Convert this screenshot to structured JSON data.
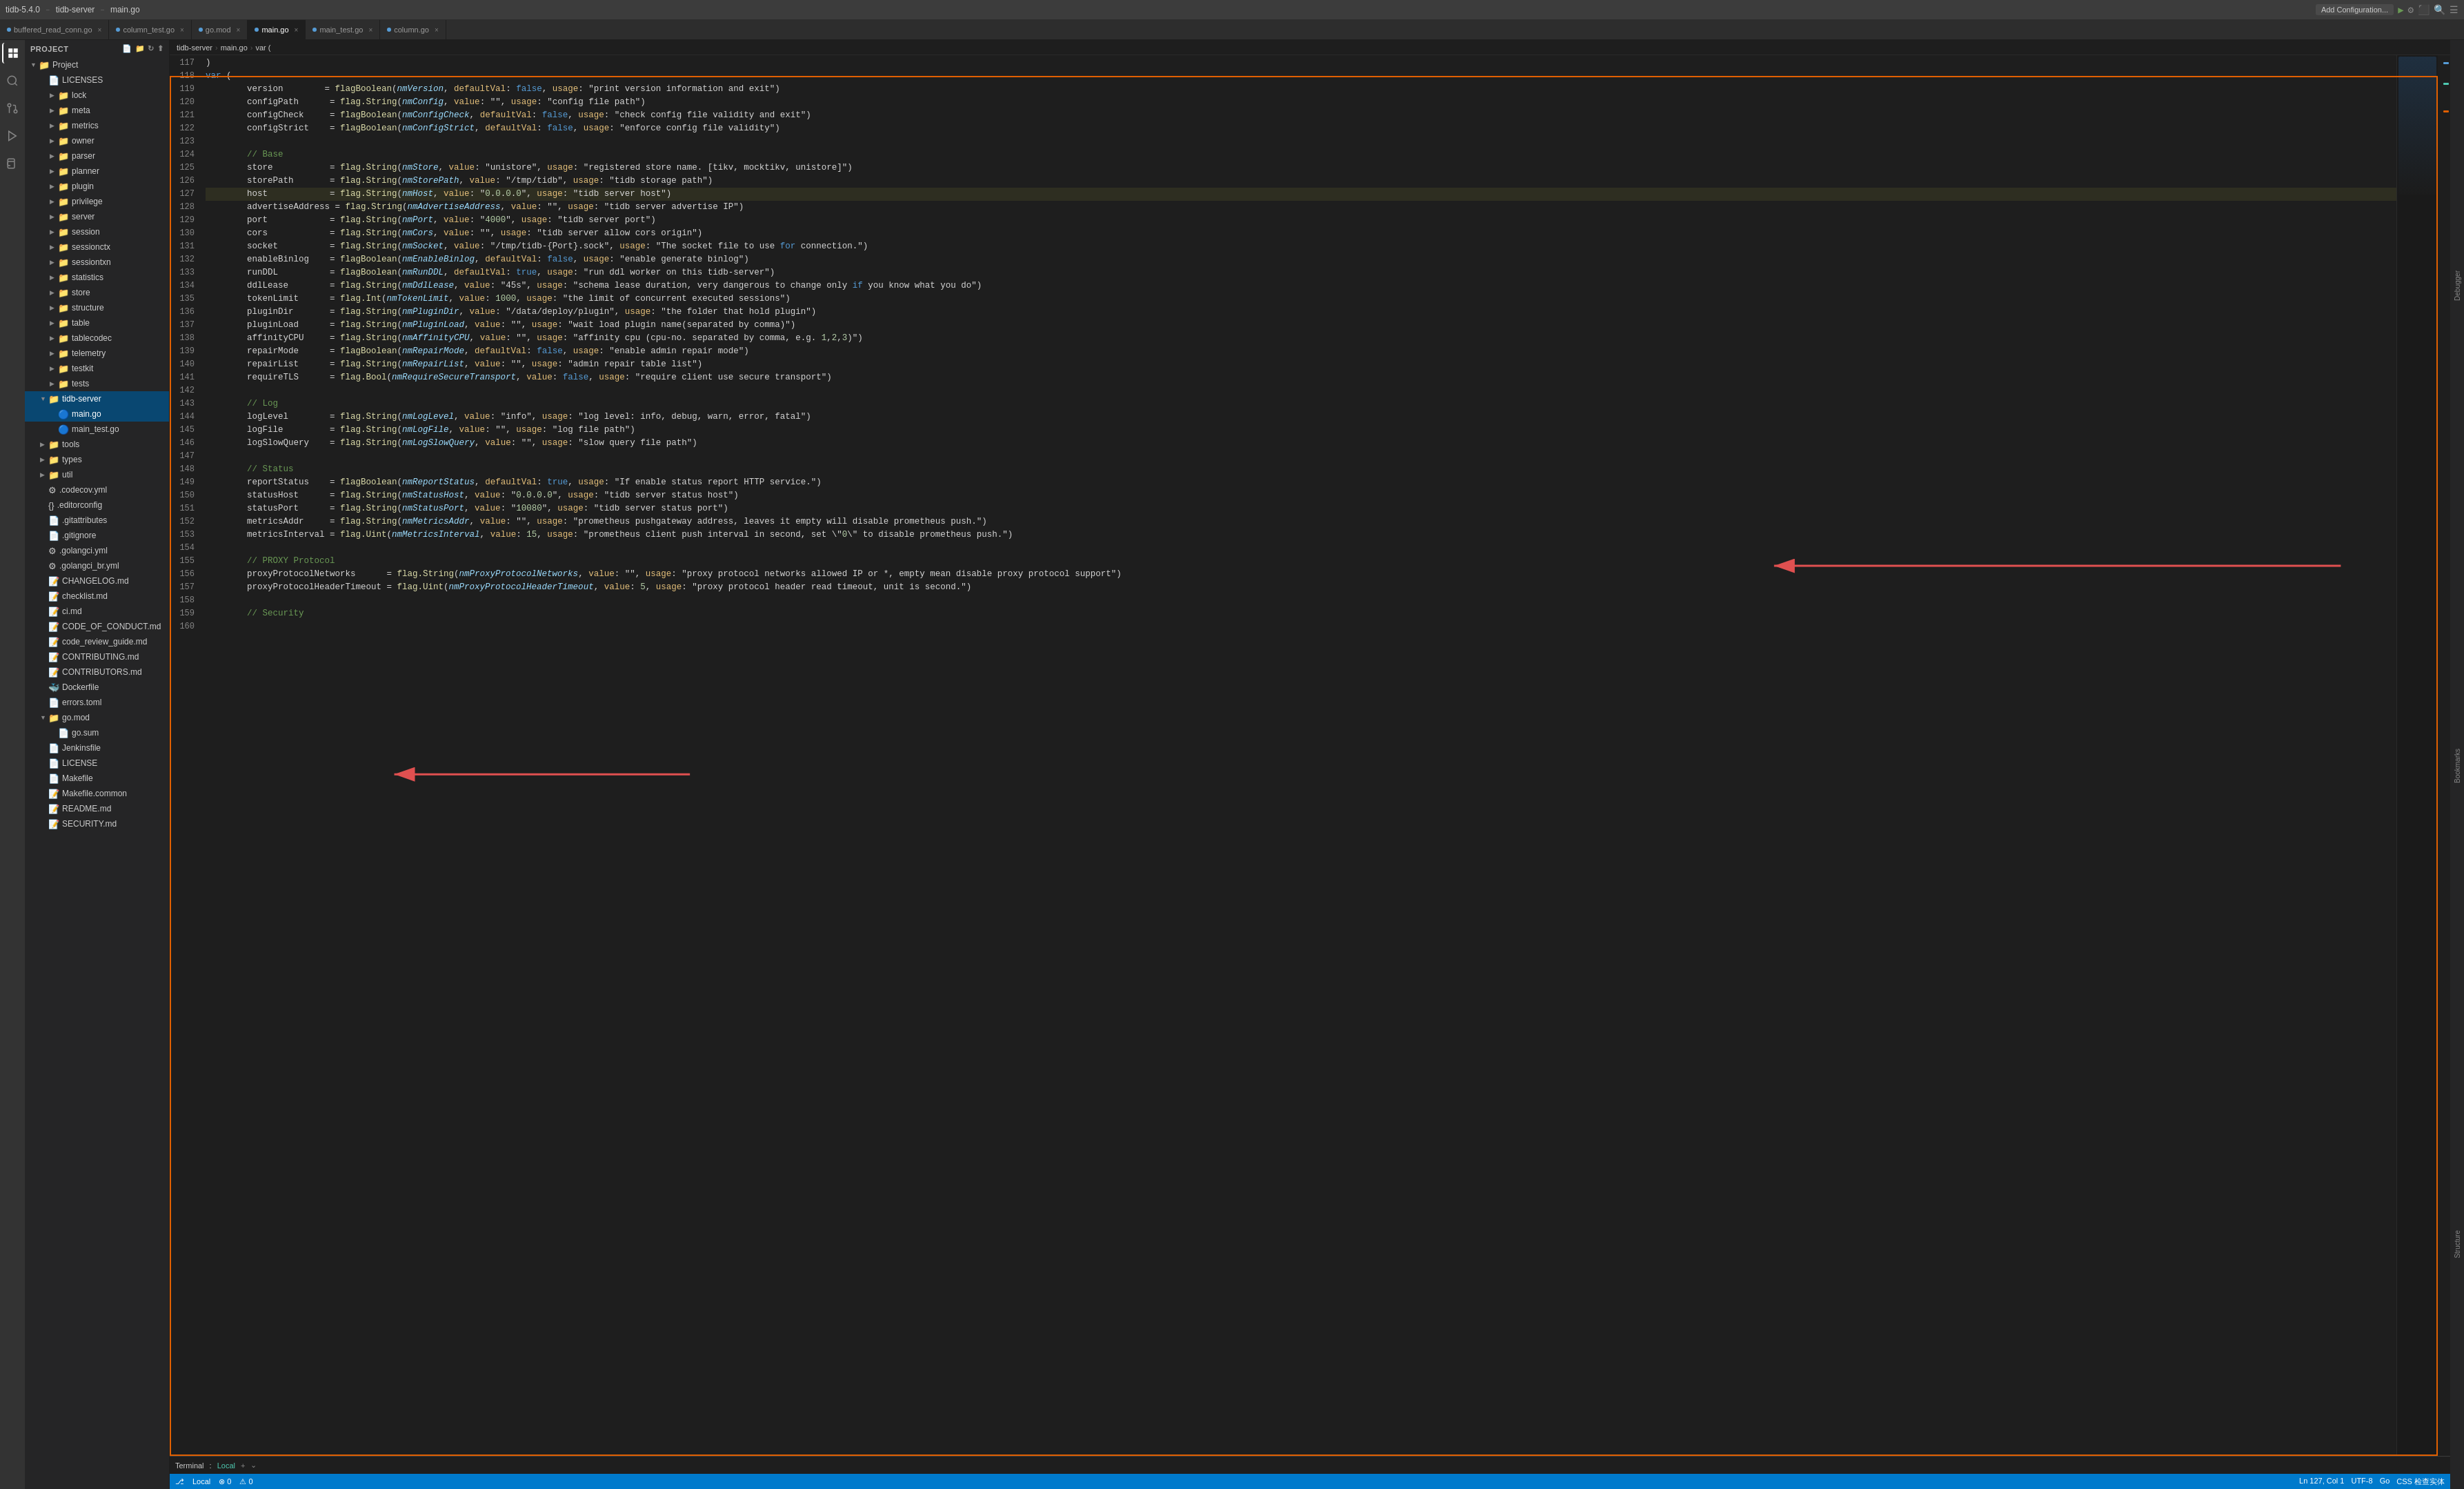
{
  "titleBar": {
    "appName": "tidb-5.4.0",
    "separator": "–",
    "file": "tidb-server",
    "subfile": "main.go",
    "addConfig": "Add Configuration...",
    "searchIcon": "🔍"
  },
  "tabs": [
    {
      "label": "buffered_read_conn.go",
      "active": false,
      "dotColor": "#569cd6"
    },
    {
      "label": "column_test.go",
      "active": false,
      "dotColor": "#569cd6"
    },
    {
      "label": "go.mod",
      "active": false,
      "dotColor": "#569cd6"
    },
    {
      "label": "main.go",
      "active": true,
      "dotColor": "#569cd6"
    },
    {
      "label": "main_test.go",
      "active": false,
      "dotColor": "#569cd6"
    },
    {
      "label": "column.go",
      "active": false,
      "dotColor": "#569cd6"
    }
  ],
  "breadcrumb": {
    "parts": [
      "tidb-server",
      ">",
      "main.go",
      ">",
      "var ("
    ]
  },
  "sidebar": {
    "header": "Project",
    "items": [
      {
        "indent": 0,
        "type": "folder",
        "open": true,
        "label": "Project"
      },
      {
        "indent": 1,
        "type": "file",
        "label": "LICENSES",
        "ext": "none"
      },
      {
        "indent": 2,
        "type": "folder",
        "open": false,
        "label": "lock"
      },
      {
        "indent": 2,
        "type": "folder",
        "open": false,
        "label": "meta"
      },
      {
        "indent": 2,
        "type": "folder",
        "open": false,
        "label": "metrics"
      },
      {
        "indent": 2,
        "type": "folder",
        "open": false,
        "label": "owner"
      },
      {
        "indent": 2,
        "type": "folder",
        "open": false,
        "label": "parser"
      },
      {
        "indent": 2,
        "type": "folder",
        "open": false,
        "label": "planner"
      },
      {
        "indent": 2,
        "type": "folder",
        "open": false,
        "label": "plugin"
      },
      {
        "indent": 2,
        "type": "folder",
        "open": false,
        "label": "privilege"
      },
      {
        "indent": 2,
        "type": "folder",
        "open": false,
        "label": "server"
      },
      {
        "indent": 2,
        "type": "folder",
        "open": false,
        "label": "session"
      },
      {
        "indent": 2,
        "type": "folder",
        "open": false,
        "label": "sessionctx"
      },
      {
        "indent": 2,
        "type": "folder",
        "open": false,
        "label": "sessiontxn"
      },
      {
        "indent": 2,
        "type": "folder",
        "open": false,
        "label": "statistics"
      },
      {
        "indent": 2,
        "type": "folder",
        "open": false,
        "label": "store"
      },
      {
        "indent": 2,
        "type": "folder",
        "open": false,
        "label": "structure"
      },
      {
        "indent": 2,
        "type": "folder",
        "open": false,
        "label": "table"
      },
      {
        "indent": 2,
        "type": "folder",
        "open": false,
        "label": "tablecodec"
      },
      {
        "indent": 2,
        "type": "folder",
        "open": false,
        "label": "telemetry"
      },
      {
        "indent": 2,
        "type": "folder",
        "open": false,
        "label": "testkit"
      },
      {
        "indent": 2,
        "type": "folder",
        "open": false,
        "label": "tests"
      },
      {
        "indent": 1,
        "type": "folder",
        "open": true,
        "label": "tidb-server",
        "selected": true
      },
      {
        "indent": 2,
        "type": "gofile",
        "label": "main.go",
        "selected": true
      },
      {
        "indent": 2,
        "type": "gofile",
        "label": "main_test.go"
      },
      {
        "indent": 1,
        "type": "folder",
        "open": false,
        "label": "tools"
      },
      {
        "indent": 1,
        "type": "folder",
        "open": false,
        "label": "types"
      },
      {
        "indent": 1,
        "type": "folder",
        "open": false,
        "label": "util"
      },
      {
        "indent": 1,
        "type": "yamlfile",
        "label": ".codecov.yml"
      },
      {
        "indent": 1,
        "type": "jsonfile",
        "label": ".editorconfig"
      },
      {
        "indent": 1,
        "type": "file",
        "label": ".gitattributes"
      },
      {
        "indent": 1,
        "type": "file",
        "label": ".gitignore"
      },
      {
        "indent": 1,
        "type": "yamlfile",
        "label": ".golangci.yml"
      },
      {
        "indent": 1,
        "type": "yamlfile",
        "label": ".golangci_br.yml"
      },
      {
        "indent": 1,
        "type": "mdfile",
        "label": "CHANGELOG.md"
      },
      {
        "indent": 1,
        "type": "mdfile",
        "label": "checklist.md"
      },
      {
        "indent": 1,
        "type": "mdfile",
        "label": "ci.md"
      },
      {
        "indent": 1,
        "type": "mdfile",
        "label": "CODE_OF_CONDUCT.md"
      },
      {
        "indent": 1,
        "type": "mdfile",
        "label": "code_review_guide.md"
      },
      {
        "indent": 1,
        "type": "mdfile",
        "label": "CONTRIBUTING.md"
      },
      {
        "indent": 1,
        "type": "mdfile",
        "label": "CONTRIBUTORS.md"
      },
      {
        "indent": 1,
        "type": "dockerfile",
        "label": "Dockerfile"
      },
      {
        "indent": 1,
        "type": "tomlfile",
        "label": "errors.toml"
      },
      {
        "indent": 1,
        "type": "folder",
        "open": true,
        "label": "go.mod"
      },
      {
        "indent": 2,
        "type": "file",
        "label": "go.sum"
      },
      {
        "indent": 1,
        "type": "file",
        "label": "Jenkinsfile"
      },
      {
        "indent": 1,
        "type": "file",
        "label": "LICENSE"
      },
      {
        "indent": 1,
        "type": "file",
        "label": "Makefile"
      },
      {
        "indent": 1,
        "type": "mdfile",
        "label": "Makefile.common"
      },
      {
        "indent": 1,
        "type": "mdfile",
        "label": "README.md"
      },
      {
        "indent": 1,
        "type": "mdfile",
        "label": "SECURITY.md"
      }
    ]
  },
  "codeLines": [
    {
      "num": 117,
      "text": ")"
    },
    {
      "num": 118,
      "text": "var ("
    },
    {
      "num": 119,
      "text": "\tversion        = flagBoolean(nmVersion, defaultVal: false, usage: \"print version information and exit\")"
    },
    {
      "num": 120,
      "text": "\tconfigPath      = flag.String(nmConfig, value: \"\", usage: \"config file path\")"
    },
    {
      "num": 121,
      "text": "\tconfigCheck     = flagBoolean(nmConfigCheck, defaultVal: false, usage: \"check config file validity and exit\")"
    },
    {
      "num": 122,
      "text": "\tconfigStrict    = flagBoolean(nmConfigStrict, defaultVal: false, usage: \"enforce config file validity\")"
    },
    {
      "num": 123,
      "text": ""
    },
    {
      "num": 124,
      "text": "\t// Base"
    },
    {
      "num": 125,
      "text": "\tstore           = flag.String(nmStore, value: \"unistore\", usage: \"registered store name. [tikv, mocktikv, unistore]\")"
    },
    {
      "num": 126,
      "text": "\tstorePath       = flag.String(nmStorePath, value: \"/tmp/tidb\", usage: \"tidb storage path\")"
    },
    {
      "num": 127,
      "text": "\thost            = flag.String(nmHost, value: \"0.0.0.0\", usage: \"tidb server host\")"
    },
    {
      "num": 128,
      "text": "\tadvertiseAddress = flag.String(nmAdvertiseAddress, value: \"\", usage: \"tidb server advertise IP\")"
    },
    {
      "num": 129,
      "text": "\tport            = flag.String(nmPort, value: \"4000\", usage: \"tidb server port\")"
    },
    {
      "num": 130,
      "text": "\tcors            = flag.String(nmCors, value: \"\", usage: \"tidb server allow cors origin\")"
    },
    {
      "num": 131,
      "text": "\tsocket          = flag.String(nmSocket, value: \"/tmp/tidb-{Port}.sock\", usage: \"The socket file to use for connection.\")"
    },
    {
      "num": 132,
      "text": "\tenableBinlog    = flagBoolean(nmEnableBinlog, defaultVal: false, usage: \"enable generate binlog\")"
    },
    {
      "num": 133,
      "text": "\trunDDL          = flagBoolean(nmRunDDL, defaultVal: true, usage: \"run ddl worker on this tidb-server\")"
    },
    {
      "num": 134,
      "text": "\tddlLease        = flag.String(nmDdlLease, value: \"45s\", usage: \"schema lease duration, very dangerous to change only if you know what you do\")"
    },
    {
      "num": 135,
      "text": "\ttokenLimit      = flag.Int(nmTokenLimit, value: 1000, usage: \"the limit of concurrent executed sessions\")"
    },
    {
      "num": 136,
      "text": "\tpluginDir       = flag.String(nmPluginDir, value: \"/data/deploy/plugin\", usage: \"the folder that hold plugin\")"
    },
    {
      "num": 137,
      "text": "\tpluginLoad      = flag.String(nmPluginLoad, value: \"\", usage: \"wait load plugin name(separated by comma)\")"
    },
    {
      "num": 138,
      "text": "\taffinityCPU     = flag.String(nmAffinityCPU, value: \"\", usage: \"affinity cpu (cpu-no. separated by comma, e.g. 1,2,3)\")"
    },
    {
      "num": 139,
      "text": "\trepairMode      = flagBoolean(nmRepairMode, defaultVal: false, usage: \"enable admin repair mode\")"
    },
    {
      "num": 140,
      "text": "\trepairList      = flag.String(nmRepairList, value: \"\", usage: \"admin repair table list\")"
    },
    {
      "num": 141,
      "text": "\trequireTLS      = flag.Bool(nmRequireSecureTransport, value: false, usage: \"require client use secure transport\")"
    },
    {
      "num": 142,
      "text": ""
    },
    {
      "num": 143,
      "text": "\t// Log"
    },
    {
      "num": 144,
      "text": "\tlogLevel        = flag.String(nmLogLevel, value: \"info\", usage: \"log level: info, debug, warn, error, fatal\")"
    },
    {
      "num": 145,
      "text": "\tlogFile         = flag.String(nmLogFile, value: \"\", usage: \"log file path\")"
    },
    {
      "num": 146,
      "text": "\tlogSlowQuery    = flag.String(nmLogSlowQuery, value: \"\", usage: \"slow query file path\")"
    },
    {
      "num": 147,
      "text": ""
    },
    {
      "num": 148,
      "text": "\t// Status"
    },
    {
      "num": 149,
      "text": "\treportStatus    = flagBoolean(nmReportStatus, defaultVal: true, usage: \"If enable status report HTTP service.\")"
    },
    {
      "num": 150,
      "text": "\tstatusHost      = flag.String(nmStatusHost, value: \"0.0.0.0\", usage: \"tidb server status host\")"
    },
    {
      "num": 151,
      "text": "\tstatusPort      = flag.String(nmStatusPort, value: \"10080\", usage: \"tidb server status port\")"
    },
    {
      "num": 152,
      "text": "\tmetricsAddr     = flag.String(nmMetricsAddr, value: \"\", usage: \"prometheus pushgateway address, leaves it empty will disable prometheus push.\")"
    },
    {
      "num": 153,
      "text": "\tmetricsInterval = flag.Uint(nmMetricsInterval, value: 15, usage: \"prometheus client push interval in second, set \\\"0\\\" to disable prometheus push.\")"
    },
    {
      "num": 154,
      "text": ""
    },
    {
      "num": 155,
      "text": "\t// PROXY Protocol"
    },
    {
      "num": 156,
      "text": "\tproxyProtocolNetworks      = flag.String(nmProxyProtocolNetworks, value: \"\", usage: \"proxy protocol networks allowed IP or *, empty mean disable proxy protocol support\")"
    },
    {
      "num": 157,
      "text": "\tproxyProtocolHeaderTimeout = flag.Uint(nmProxyProtocolHeaderTimeout, value: 5, usage: \"proxy protocol header read timeout, unit is second.\")"
    },
    {
      "num": 158,
      "text": ""
    },
    {
      "num": 159,
      "text": "\t// Security"
    },
    {
      "num": 160,
      "text": ""
    }
  ],
  "statusBar": {
    "branch": "Local",
    "lineCol": "Ln 127, Col 1",
    "encoding": "UTF-8",
    "language": "Go",
    "goVersion": "CSS 检查实体",
    "rightText": "CSS 检查实体"
  },
  "terminal": {
    "label": "Terminal",
    "branch": "Local",
    "plus": "+"
  },
  "rightSideLabels": {
    "debugger": "Debugger",
    "bookmarks": "Bookmarks",
    "structure": "Structure"
  }
}
